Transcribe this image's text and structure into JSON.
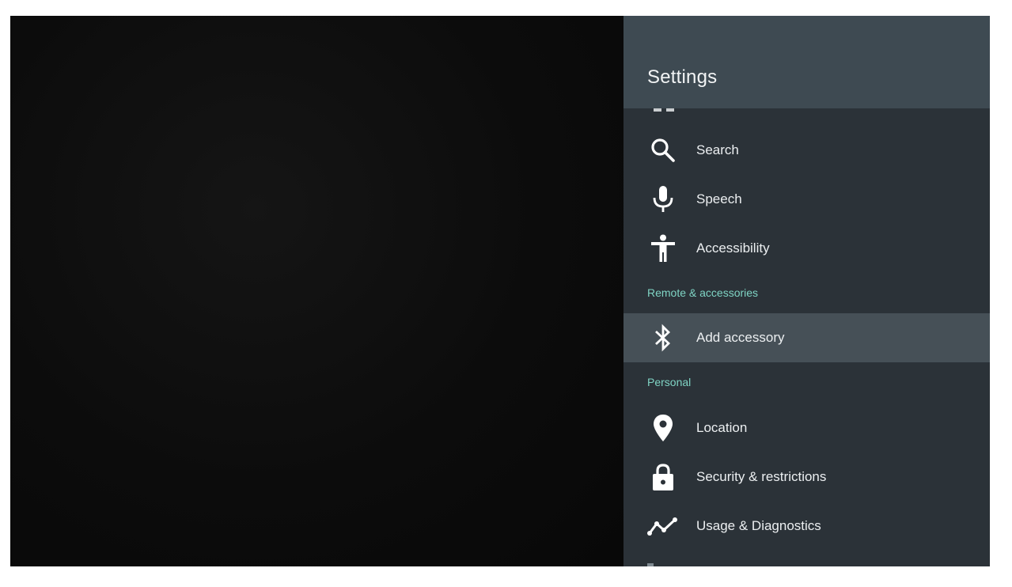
{
  "panel": {
    "title": "Settings"
  },
  "menu": {
    "items": [
      {
        "label": "Search",
        "icon": "search-icon"
      },
      {
        "label": "Speech",
        "icon": "microphone-icon"
      },
      {
        "label": "Accessibility",
        "icon": "accessibility-icon"
      }
    ],
    "remote_section": {
      "header": "Remote & accessories",
      "items": [
        {
          "label": "Add accessory",
          "icon": "bluetooth-icon",
          "focused": true
        }
      ]
    },
    "personal_section": {
      "header": "Personal",
      "items": [
        {
          "label": "Location",
          "icon": "location-pin-icon"
        },
        {
          "label": "Security & restrictions",
          "icon": "lock-icon"
        },
        {
          "label": "Usage & Diagnostics",
          "icon": "diagnostics-graph-icon"
        }
      ]
    }
  },
  "colors": {
    "panel_background": "#2b3238",
    "header_background": "#3e4a52",
    "focused_row": "#465057",
    "section_header": "#7fd4c4"
  }
}
